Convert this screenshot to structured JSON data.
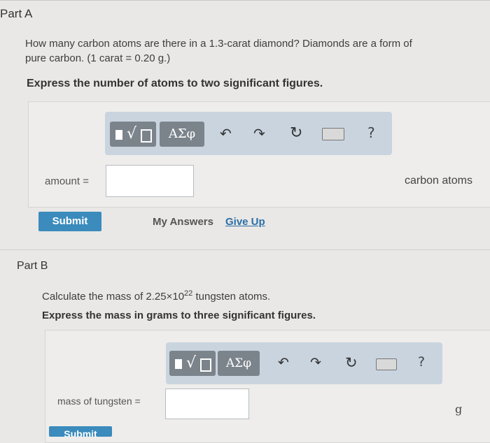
{
  "partA": {
    "title": "Part A",
    "question_line1": "How many carbon atoms are there in a 1.3-carat diamond? Diamonds are a form of",
    "question_line2": "pure carbon. (1 carat = 0.20 g.)",
    "instruction": "Express the number of atoms to two significant figures.",
    "toolbar": {
      "template_label": "√",
      "greek_label": "ΑΣφ",
      "help_label": "?"
    },
    "field_label": "amount =",
    "field_value": "",
    "unit": "carbon atoms",
    "submit_label": "Submit",
    "my_answers_label": "My Answers",
    "give_up_label": "Give Up"
  },
  "partB": {
    "title": "Part B",
    "question_prefix": "Calculate the mass of 2.25×10",
    "question_exponent": "22",
    "question_suffix": " tungsten atoms.",
    "instruction": "Express the mass in grams to three significant figures.",
    "toolbar": {
      "template_label": "√",
      "greek_label": "ΑΣφ",
      "help_label": "?"
    },
    "field_label": "mass of tungsten =",
    "field_value": "",
    "unit": "g",
    "submit_label": "Submit"
  },
  "colors": {
    "accent": "#3b8bbd",
    "toolbar_bg": "#c9d4df",
    "toolbar_btn": "#7b838b"
  }
}
